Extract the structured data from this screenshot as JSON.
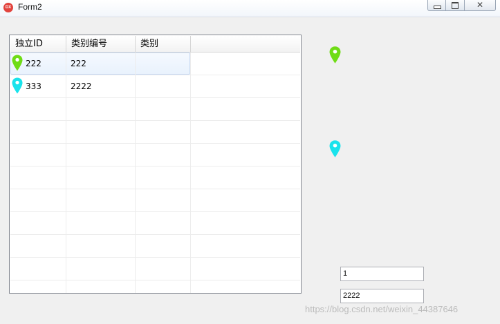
{
  "window": {
    "title": "Form2",
    "app_icon_text": "DX",
    "buttons": {
      "minimize": "",
      "maximize": "",
      "close": "✕"
    }
  },
  "grid": {
    "columns": [
      "独立ID",
      "类别编号",
      "类别"
    ],
    "rows": [
      {
        "id": "222",
        "category_no": "222",
        "category": "",
        "pin_color": "#6fdc16",
        "selected": true
      },
      {
        "id": "333",
        "category_no": "2222",
        "category": "",
        "pin_color": "#19e3ec",
        "selected": false
      }
    ],
    "empty_rows": 9
  },
  "map_markers": [
    {
      "icon": "map-pin-icon",
      "color": "#6fdc16"
    },
    {
      "icon": "map-pin-icon",
      "color": "#19e3ec"
    }
  ],
  "fields": {
    "field1_value": "1",
    "field2_value": "2222"
  },
  "watermark": "https://blog.csdn.net/weixin_44387646"
}
